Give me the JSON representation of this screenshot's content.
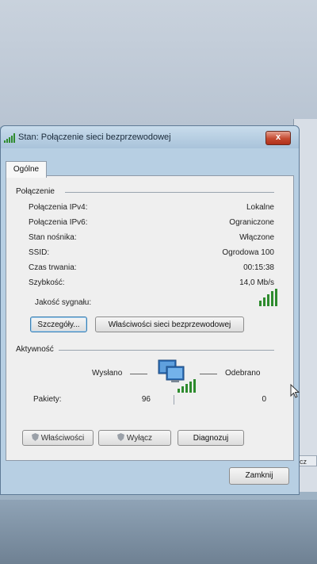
{
  "window": {
    "title": "Stan: Połączenie sieci bezprzewodowej",
    "close_glyph": "x"
  },
  "tabs": [
    {
      "label": "Ogólne"
    }
  ],
  "connection": {
    "heading": "Połączenie",
    "rows": [
      {
        "label": "Połączenia IPv4:",
        "value": "Lokalne"
      },
      {
        "label": "Połączenia IPv6:",
        "value": "Ograniczone"
      },
      {
        "label": "Stan nośnika:",
        "value": "Włączone"
      },
      {
        "label": "SSID:",
        "value": "Ogrodowa 100"
      },
      {
        "label": "Czas trwania:",
        "value": "00:15:38"
      },
      {
        "label": "Szybkość:",
        "value": "14,0 Mb/s"
      }
    ],
    "signal_label": "Jakość sygnału:",
    "signal_bars": 5,
    "buttons": {
      "details": "Szczegóły...",
      "wireless_properties": "Właściwości sieci bezprzewodowej"
    }
  },
  "activity": {
    "heading": "Aktywność",
    "sent_label": "Wysłano",
    "received_label": "Odebrano",
    "packets_label": "Pakiety:",
    "packets_sent": "96",
    "packets_received": "0"
  },
  "actions": {
    "properties": "Właściwości",
    "disable": "Wyłącz",
    "diagnose": "Diagnozuj"
  },
  "footer": {
    "close": "Zamknij"
  },
  "background": {
    "sliver_text": "acz"
  },
  "colors": {
    "accent": "#3c7fb1",
    "close_red": "#c44a30",
    "signal_green": "#2e8b2e"
  }
}
